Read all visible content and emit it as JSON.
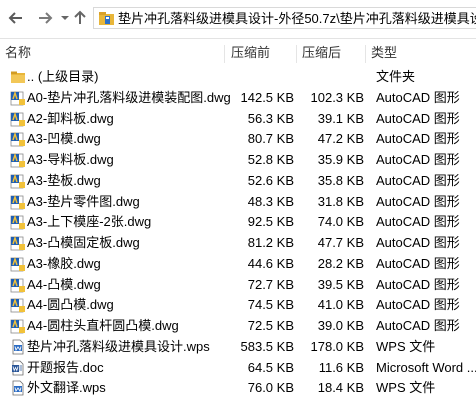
{
  "window": {
    "address_path": "垫片冲孔落料级进模具设计-外径50.7z\\垫片冲孔落料级进模具设计-"
  },
  "columns": {
    "name": "名称",
    "compressed": "压缩前",
    "original": "压缩后",
    "type": "类型"
  },
  "rows": [
    {
      "name": ".. (上级目录)",
      "compressed": "",
      "original": "",
      "type": "文件夹",
      "icon": "folder-icon"
    },
    {
      "name": "A0-垫片冲孔落料级进模装配图.dwg",
      "compressed": "142.5 KB",
      "original": "102.3 KB",
      "type": "AutoCAD 图形",
      "icon": "autocad-file-icon"
    },
    {
      "name": "A2-卸料板.dwg",
      "compressed": "56.3 KB",
      "original": "39.1 KB",
      "type": "AutoCAD 图形",
      "icon": "autocad-file-icon"
    },
    {
      "name": "A3-凹模.dwg",
      "compressed": "80.7 KB",
      "original": "47.2 KB",
      "type": "AutoCAD 图形",
      "icon": "autocad-file-icon"
    },
    {
      "name": "A3-导料板.dwg",
      "compressed": "52.8 KB",
      "original": "35.9 KB",
      "type": "AutoCAD 图形",
      "icon": "autocad-file-icon"
    },
    {
      "name": "A3-垫板.dwg",
      "compressed": "52.6 KB",
      "original": "35.8 KB",
      "type": "AutoCAD 图形",
      "icon": "autocad-file-icon"
    },
    {
      "name": "A3-垫片零件图.dwg",
      "compressed": "48.3 KB",
      "original": "31.8 KB",
      "type": "AutoCAD 图形",
      "icon": "autocad-file-icon"
    },
    {
      "name": "A3-上下模座-2张.dwg",
      "compressed": "92.5 KB",
      "original": "74.0 KB",
      "type": "AutoCAD 图形",
      "icon": "autocad-file-icon"
    },
    {
      "name": "A3-凸模固定板.dwg",
      "compressed": "81.2 KB",
      "original": "47.7 KB",
      "type": "AutoCAD 图形",
      "icon": "autocad-file-icon"
    },
    {
      "name": "A3-橡胶.dwg",
      "compressed": "44.6 KB",
      "original": "28.2 KB",
      "type": "AutoCAD 图形",
      "icon": "autocad-file-icon"
    },
    {
      "name": "A4-凸模.dwg",
      "compressed": "72.7 KB",
      "original": "39.5 KB",
      "type": "AutoCAD 图形",
      "icon": "autocad-file-icon"
    },
    {
      "name": "A4-圆凸模.dwg",
      "compressed": "74.5 KB",
      "original": "41.0 KB",
      "type": "AutoCAD 图形",
      "icon": "autocad-file-icon"
    },
    {
      "name": "A4-圆柱头直杆圆凸模.dwg",
      "compressed": "72.5 KB",
      "original": "39.0 KB",
      "type": "AutoCAD 图形",
      "icon": "autocad-file-icon"
    },
    {
      "name": "垫片冲孔落料级进模具设计.wps",
      "compressed": "583.5 KB",
      "original": "178.0 KB",
      "type": "WPS 文件",
      "icon": "wps-file-icon"
    },
    {
      "name": "开题报告.doc",
      "compressed": "64.5 KB",
      "original": "11.6 KB",
      "type": "Microsoft Word ...",
      "icon": "word-file-icon"
    },
    {
      "name": "外文翻译.wps",
      "compressed": "76.0 KB",
      "original": "18.4 KB",
      "type": "WPS 文件",
      "icon": "wps-file-icon"
    }
  ],
  "colors": {
    "folder": "#e8b63a",
    "autocad_blue": "#1f5fb3",
    "autocad_yellow": "#f2c23a",
    "wps_blue": "#2b6cc4",
    "word_blue": "#2a5699"
  }
}
